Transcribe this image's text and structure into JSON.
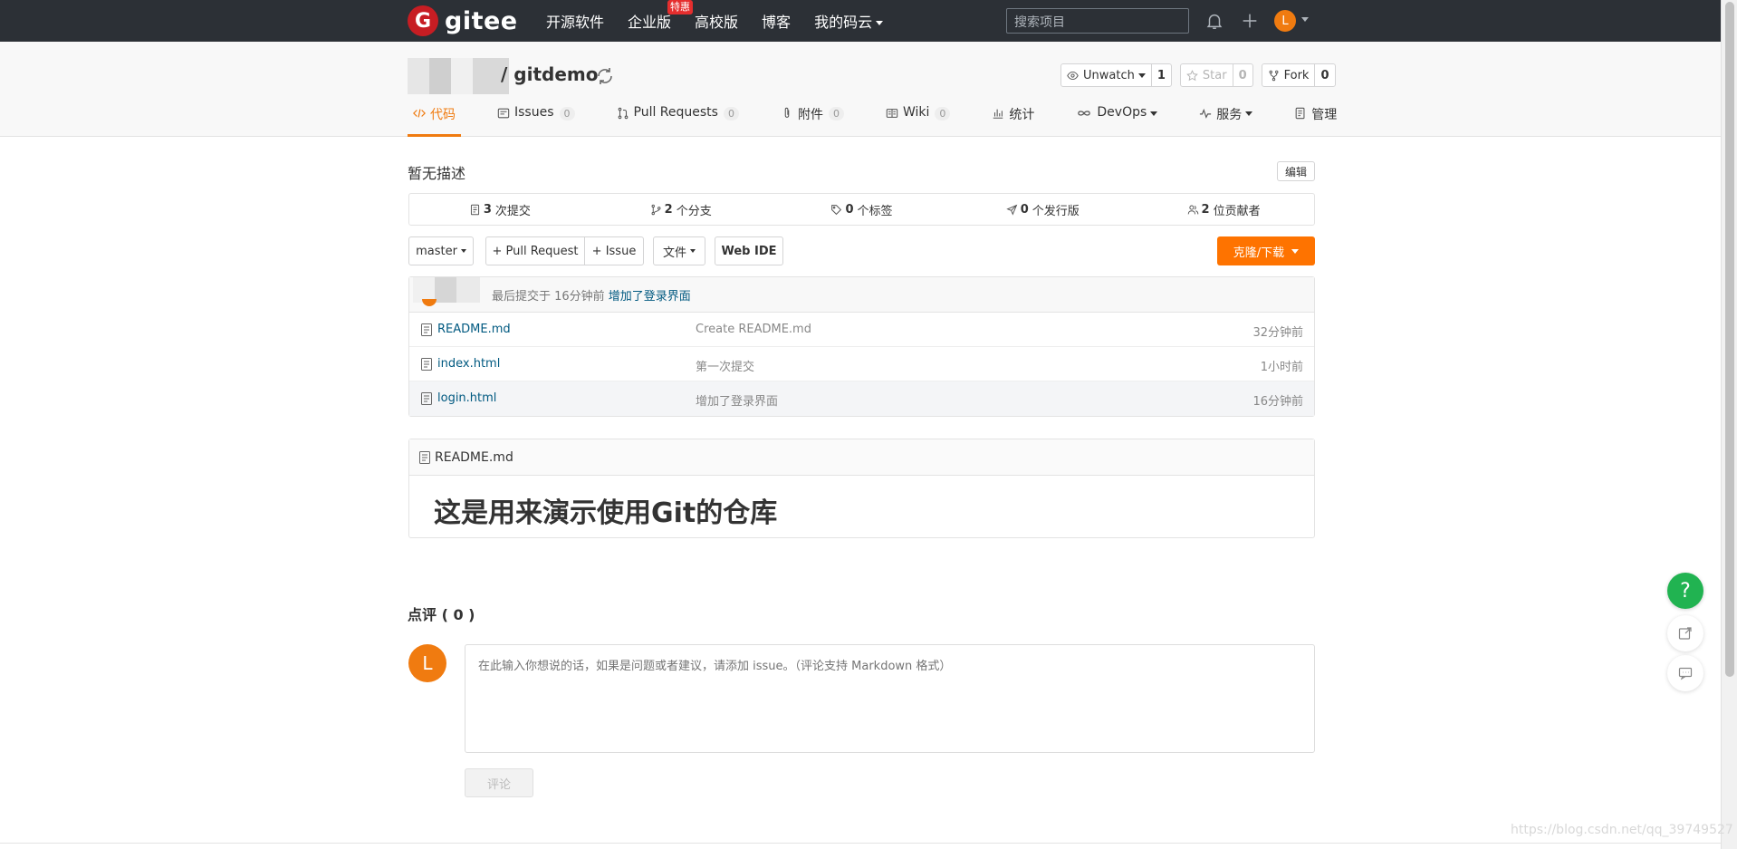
{
  "brand": {
    "name": "gitee",
    "mark": "G",
    "accent": "#c71d23",
    "orange": "#fe7300"
  },
  "topnav": {
    "items": [
      {
        "label": "开源软件"
      },
      {
        "label": "企业版",
        "badge": "特惠"
      },
      {
        "label": "高校版"
      },
      {
        "label": "博客"
      },
      {
        "label": "我的码云"
      }
    ],
    "search_placeholder": "搜索项目",
    "avatar_letter": "L"
  },
  "repo": {
    "name": "gitdemo",
    "separator": "/",
    "watch": {
      "label": "Unwatch",
      "count": "1"
    },
    "star": {
      "label": "Star",
      "count": "0"
    },
    "fork": {
      "label": "Fork",
      "count": "0"
    }
  },
  "tabs": [
    {
      "label": "代码",
      "icon": "code-icon"
    },
    {
      "label": "Issues",
      "count": "0",
      "icon": "issues-icon"
    },
    {
      "label": "Pull Requests",
      "count": "0",
      "icon": "pull-request-icon"
    },
    {
      "label": "附件",
      "count": "0",
      "icon": "attachment-icon"
    },
    {
      "label": "Wiki",
      "count": "0",
      "icon": "wiki-icon"
    },
    {
      "label": "统计",
      "icon": "stats-icon"
    },
    {
      "label": "DevOps",
      "icon": "devops-icon"
    },
    {
      "label": "服务",
      "icon": "service-icon"
    },
    {
      "label": "管理",
      "icon": "manage-icon"
    }
  ],
  "description": "暂无描述",
  "edit_label": "编辑",
  "stats": [
    {
      "num": "3",
      "label": "次提交"
    },
    {
      "num": "2",
      "label": "个分支"
    },
    {
      "num": "0",
      "label": "个标签"
    },
    {
      "num": "0",
      "label": "个发行版"
    },
    {
      "num": "2",
      "label": "位贡献者"
    }
  ],
  "toolbar": {
    "branch": "master",
    "pull_request": "+ Pull Request",
    "issue": "+ Issue",
    "file": "文件",
    "webide": "Web IDE",
    "clone": "克隆/下载"
  },
  "last_commit": {
    "prefix": "最后提交于 16分钟前",
    "message": "增加了登录界面"
  },
  "files": [
    {
      "name": "README.md",
      "commit": "Create README.md",
      "time": "32分钟前"
    },
    {
      "name": "index.html",
      "commit": "第一次提交",
      "time": "1小时前"
    },
    {
      "name": "login.html",
      "commit": "增加了登录界面",
      "time": "16分钟前"
    }
  ],
  "readme": {
    "filename": "README.md",
    "heading": "这是用来演示使用Git的仓库"
  },
  "comments": {
    "title": "点评 ( 0 )",
    "avatar_letter": "L",
    "placeholder": "在此输入你想说的话，如果是问题或者建议，请添加 issue。（评论支持 Markdown 格式）",
    "submit": "评论"
  },
  "float": {
    "help": "?"
  },
  "watermark": "https://blog.csdn.net/qq_39749527"
}
